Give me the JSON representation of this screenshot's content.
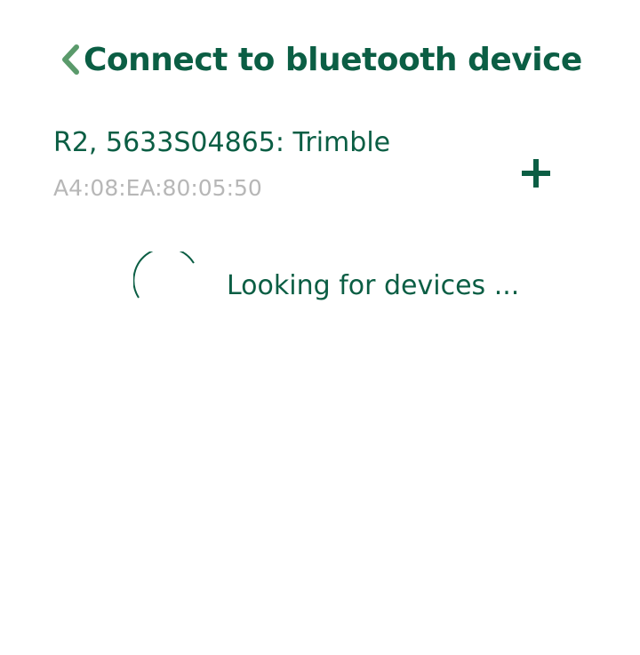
{
  "header": {
    "title": "Connect to bluetooth device",
    "back_icon": "chevron-left-icon"
  },
  "devices": [
    {
      "name": "R2, 5633S04865: Trimble",
      "address": "A4:08:EA:80:05:50",
      "action_icon": "plus-icon"
    }
  ],
  "status": {
    "loading_text": "Looking for devices ...",
    "spinner_icon": "loading-spinner-icon"
  },
  "colors": {
    "accent": "#0b5e44",
    "back_icon": "#5a9a6b",
    "secondary_text": "#b7b7b7",
    "background": "#ffffff"
  }
}
